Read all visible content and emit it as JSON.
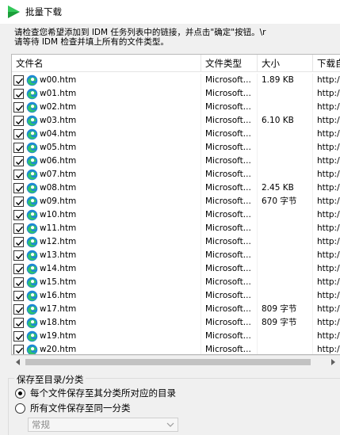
{
  "window": {
    "title": "批量下载"
  },
  "instructions": {
    "line1": "请检查您希望添加到 IDM 任务列表中的链接，并点击\"确定\"按钮。\\r",
    "line2": "请等待 IDM 检查并填上所有的文件类型。"
  },
  "table": {
    "headers": [
      "文件名",
      "文件类型",
      "大小",
      "下载自"
    ],
    "rows": [
      {
        "name": "w00.htm",
        "type": "Microsoft...",
        "size": "1.89 KB",
        "from": "http:/"
      },
      {
        "name": "w01.htm",
        "type": "Microsoft...",
        "size": "",
        "from": "http:/"
      },
      {
        "name": "w02.htm",
        "type": "Microsoft...",
        "size": "",
        "from": "http:/"
      },
      {
        "name": "w03.htm",
        "type": "Microsoft...",
        "size": "6.10 KB",
        "from": "http:/"
      },
      {
        "name": "w04.htm",
        "type": "Microsoft...",
        "size": "",
        "from": "http:/"
      },
      {
        "name": "w05.htm",
        "type": "Microsoft...",
        "size": "",
        "from": "http:/"
      },
      {
        "name": "w06.htm",
        "type": "Microsoft...",
        "size": "",
        "from": "http:/"
      },
      {
        "name": "w07.htm",
        "type": "Microsoft...",
        "size": "",
        "from": "http:/"
      },
      {
        "name": "w08.htm",
        "type": "Microsoft...",
        "size": "2.45 KB",
        "from": "http:/"
      },
      {
        "name": "w09.htm",
        "type": "Microsoft...",
        "size": "670 字节",
        "from": "http:/"
      },
      {
        "name": "w10.htm",
        "type": "Microsoft...",
        "size": "",
        "from": "http:/"
      },
      {
        "name": "w11.htm",
        "type": "Microsoft...",
        "size": "",
        "from": "http:/"
      },
      {
        "name": "w12.htm",
        "type": "Microsoft...",
        "size": "",
        "from": "http:/"
      },
      {
        "name": "w13.htm",
        "type": "Microsoft...",
        "size": "",
        "from": "http:/"
      },
      {
        "name": "w14.htm",
        "type": "Microsoft...",
        "size": "",
        "from": "http:/"
      },
      {
        "name": "w15.htm",
        "type": "Microsoft...",
        "size": "",
        "from": "http:/"
      },
      {
        "name": "w16.htm",
        "type": "Microsoft...",
        "size": "",
        "from": "http:/"
      },
      {
        "name": "w17.htm",
        "type": "Microsoft...",
        "size": "809 字节",
        "from": "http:/"
      },
      {
        "name": "w18.htm",
        "type": "Microsoft...",
        "size": "809 字节",
        "from": "http:/"
      },
      {
        "name": "w19.htm",
        "type": "Microsoft...",
        "size": "",
        "from": "http:/"
      },
      {
        "name": "w20.htm",
        "type": "Microsoft...",
        "size": "",
        "from": "http:/"
      }
    ]
  },
  "save_group": {
    "label": "保存至目录/分类",
    "option1": "每个文件保存至其分类所对应的目录",
    "option2": "所有文件保存至同一分类",
    "selected": 1,
    "category_value": "常规"
  },
  "icons": {
    "app": "idm-play-icon",
    "file": "edge-browser-icon",
    "checkbox": "checkmark-icon"
  }
}
